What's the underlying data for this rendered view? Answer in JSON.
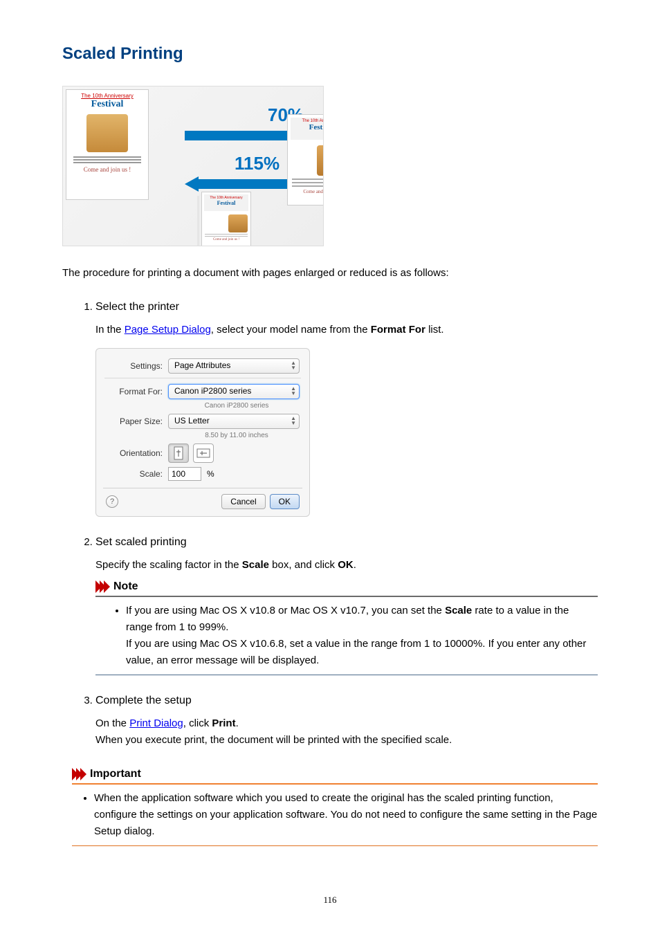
{
  "title": "Scaled Printing",
  "illustration": {
    "pct1": "70%",
    "pct2": "115%",
    "card": {
      "line1": "The 10th Anniversary",
      "line2": "Festival",
      "foot": "Come and join us !"
    }
  },
  "intro": "The procedure for printing a document with pages enlarged or reduced is as follows:",
  "steps": {
    "s1": {
      "title": "Select the printer",
      "body_pre": "In the ",
      "link": "Page Setup Dialog",
      "body_mid": ", select your model name from the ",
      "bold": "Format For",
      "body_post": " list."
    },
    "s2": {
      "title": "Set scaled printing",
      "body_pre": "Specify the scaling factor in the ",
      "bold1": "Scale",
      "body_mid": " box, and click ",
      "bold2": "OK",
      "body_post": "."
    },
    "s3": {
      "title": "Complete the setup",
      "body_pre": "On the ",
      "link": "Print Dialog",
      "body_mid": ", click ",
      "bold": "Print",
      "body_post": ".",
      "line2": "When you execute print, the document will be printed with the specified scale."
    }
  },
  "dialog": {
    "settings_label": "Settings:",
    "settings_value": "Page Attributes",
    "formatfor_label": "Format For:",
    "formatfor_value": "Canon iP2800 series",
    "formatfor_sub": "Canon iP2800 series",
    "papersize_label": "Paper Size:",
    "papersize_value": "US Letter",
    "papersize_sub": "8.50 by 11.00 inches",
    "orientation_label": "Orientation:",
    "scale_label": "Scale:",
    "scale_value": "100",
    "scale_unit": "%",
    "help": "?",
    "cancel": "Cancel",
    "ok": "OK"
  },
  "note": {
    "title": "Note",
    "li_pre": "If you are using Mac OS X v10.8 or Mac OS X v10.7, you can set the ",
    "li_bold": "Scale",
    "li_post": " rate to a value in the range from 1 to 999%.",
    "line2": "If you are using Mac OS X v10.6.8, set a value in the range from 1 to 10000%. If you enter any other value, an error message will be displayed."
  },
  "important": {
    "title": "Important",
    "text": "When the application software which you used to create the original has the scaled printing function, configure the settings on your application software. You do not need to configure the same setting in the Page Setup dialog."
  },
  "page_number": "116"
}
